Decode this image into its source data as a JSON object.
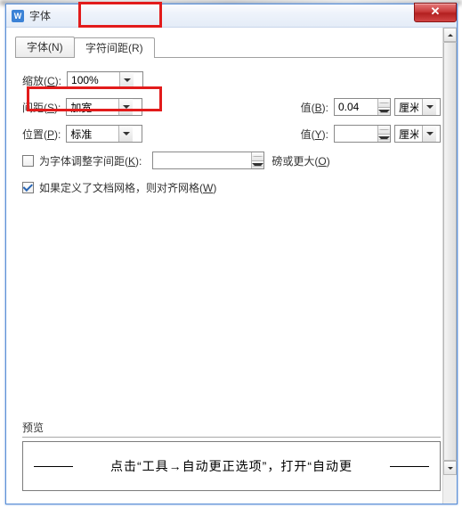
{
  "title": "字体",
  "close": "✕",
  "tabs": {
    "font": "字体(N)",
    "spacing": "字符间距(R)"
  },
  "fields": {
    "scale_label_a": "缩放(",
    "scale_key": "C",
    "scale_label_b": "):",
    "scale_value": "100%",
    "spacing_label_a": "间距(",
    "spacing_key": "S",
    "spacing_label_b": "):",
    "spacing_value": "加宽",
    "value_label_a": "值(",
    "value_key_b": "B",
    "value_label_b": "):",
    "value_b": "0.04",
    "unit_cm_a": "厘米",
    "pos_label_a": "位置(",
    "pos_key": "P",
    "pos_label_b": "):",
    "pos_value": "标准",
    "value_key_y": "Y",
    "value_y": "",
    "unit_cm_b": "厘米",
    "kern_a": "为字体调整字间距(",
    "kern_key": "K",
    "kern_b": "):",
    "kern_unit_a": "磅或更大(",
    "kern_unit_key": "O",
    "kern_unit_b": ")",
    "grid_a": "如果定义了文档网格，则对齐网格(",
    "grid_key": "W",
    "grid_b": ")"
  },
  "preview": {
    "label": "预览",
    "text": "点击“工具→自动更正选项”，打开“自动更"
  }
}
